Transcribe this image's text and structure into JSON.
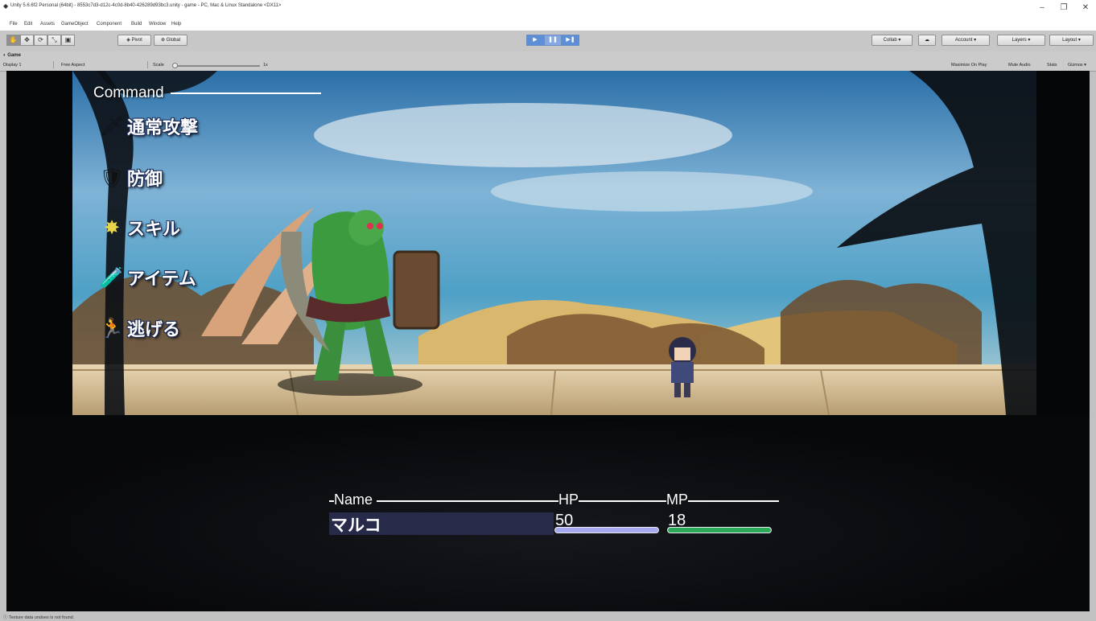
{
  "window": {
    "title": "Unity 5.6.6f2 Personal (64bit) - 8553c7d3-d12c-4c0d-8b40-426289d93bc3.unity - game - PC, Mac & Linux Standalone <DX11>",
    "minimize": "–",
    "maximize": "❐",
    "close": "✕"
  },
  "menu": [
    "File",
    "Edit",
    "Assets",
    "GameObject",
    "Component",
    "Build",
    "Window",
    "Help"
  ],
  "toolbar": {
    "pivot": "◈ Pivot",
    "global": "⊕ Global",
    "collab": "Collab ▾",
    "account": "Account ▾",
    "layers": "Layers ▾",
    "layout": "Layout ▾"
  },
  "game_tab": {
    "label": "Game",
    "display": "Display 1",
    "aspect": "Free Aspect",
    "scale_label": "Scale",
    "scale_value": "1x",
    "maximize_on_play": "Maximize On Play",
    "mute_audio": "Mute Audio",
    "stats": "Stats",
    "gizmos": "Gizmos ▾"
  },
  "battle": {
    "command_header": "Command",
    "commands": [
      {
        "label": "通常攻撃",
        "icon": "sword-icon"
      },
      {
        "label": "防御",
        "icon": "shield-icon"
      },
      {
        "label": "スキル",
        "icon": "skill-star-icon"
      },
      {
        "label": "アイテム",
        "icon": "potion-icon"
      },
      {
        "label": "逃げる",
        "icon": "run-icon"
      }
    ],
    "status": {
      "name_header": "Name",
      "hp_header": "HP",
      "mp_header": "MP",
      "name": "マルコ",
      "hp": "50",
      "mp": "18",
      "hp_fraction": 1.0,
      "mp_fraction": 1.0
    }
  },
  "status_bar": {
    "message": "Texture data undoes is not found."
  },
  "colors": {
    "hp_bar": "#a7a9f0",
    "mp_bar": "#2aa957",
    "name_highlight": "#282a4a",
    "play_button": "#5d8fd8"
  }
}
